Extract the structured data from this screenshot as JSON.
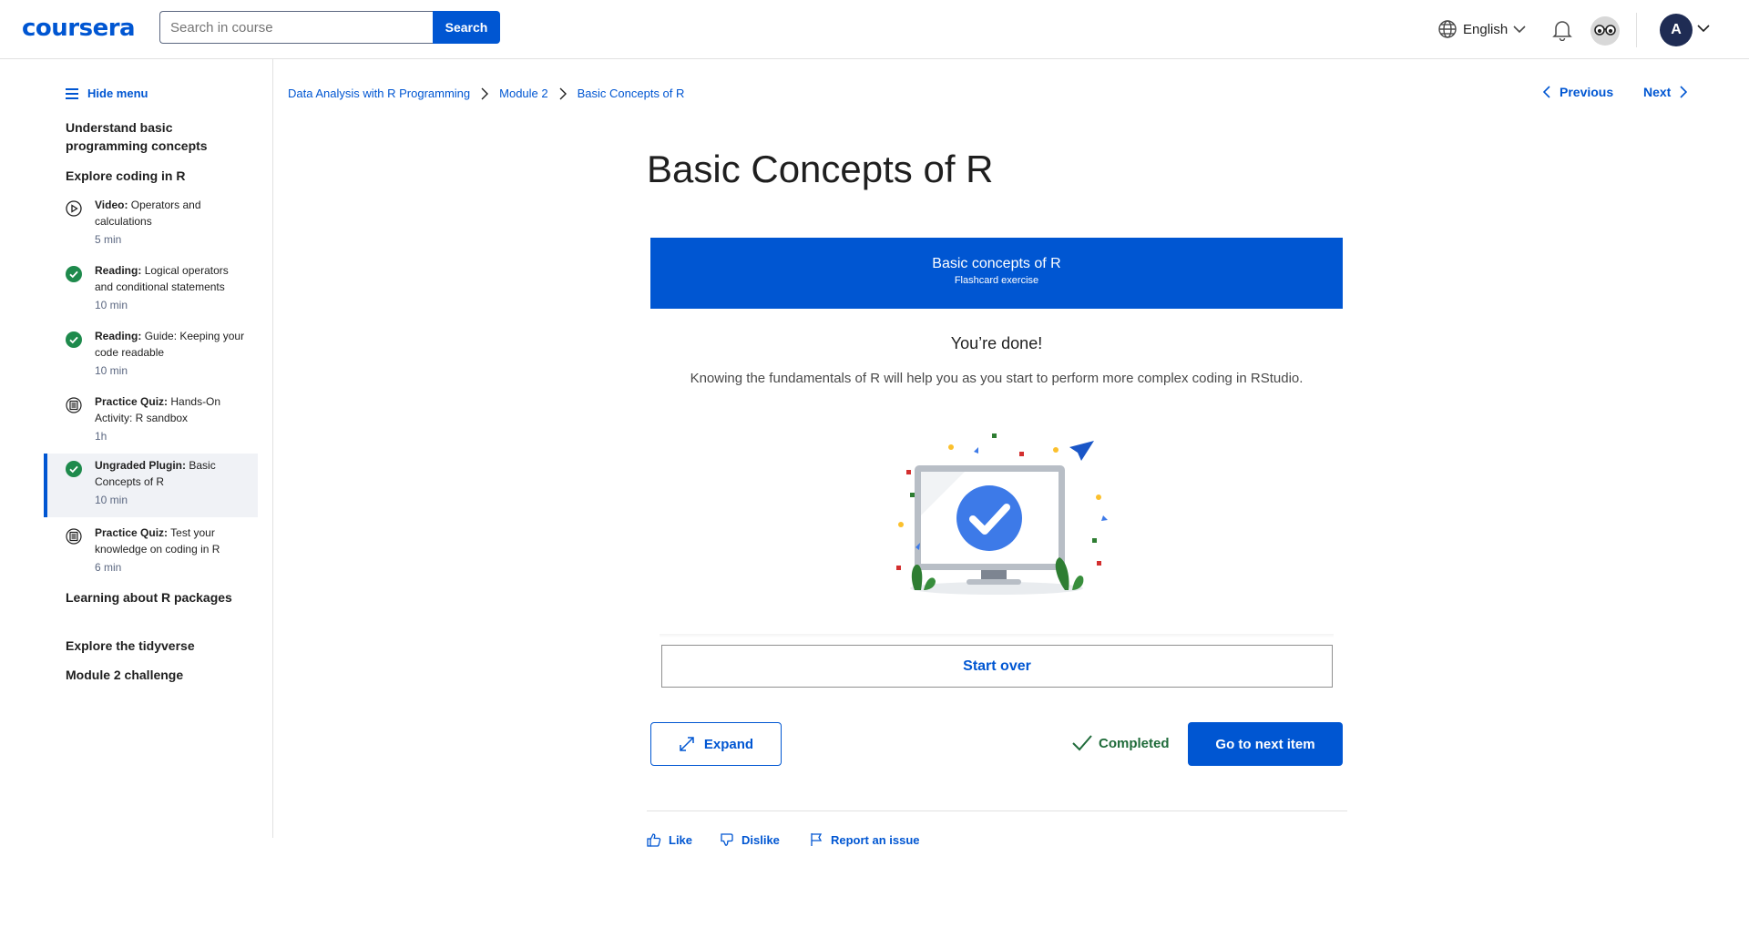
{
  "header": {
    "logo": "coursera",
    "search_placeholder": "Search in course",
    "search_button": "Search",
    "language": "English",
    "avatar_initial": "A"
  },
  "sidebar": {
    "hide_menu": "Hide menu",
    "sections_top": [
      "Understand basic programming concepts",
      "Explore coding in R"
    ],
    "items": [
      {
        "type": "Video:",
        "title": "Operators and calculations",
        "duration": "5 min",
        "icon": "play-circle-icon",
        "status": "not-started"
      },
      {
        "type": "Reading:",
        "title": "Logical operators and conditional statements",
        "duration": "10 min",
        "icon": "check-circle-icon",
        "status": "completed"
      },
      {
        "type": "Reading:",
        "title": "Guide: Keeping your code readable",
        "duration": "10 min",
        "icon": "check-circle-icon",
        "status": "completed"
      },
      {
        "type": "Practice Quiz:",
        "title": "Hands-On Activity: R sandbox",
        "duration": "1h",
        "icon": "quiz-icon",
        "status": "not-started"
      },
      {
        "type": "Ungraded Plugin:",
        "title": "Basic Concepts of R",
        "duration": "10 min",
        "icon": "check-circle-icon",
        "status": "completed"
      },
      {
        "type": "Practice Quiz:",
        "title": "Test your knowledge on coding in R",
        "duration": "6 min",
        "icon": "quiz-icon",
        "status": "not-started"
      }
    ],
    "sections_bottom": [
      "Learning about R packages",
      "Explore the tidyverse",
      "Module 2 challenge"
    ]
  },
  "breadcrumb": [
    "Data Analysis with R Programming",
    "Module 2",
    "Basic Concepts of R"
  ],
  "nav": {
    "previous": "Previous",
    "next": "Next"
  },
  "page_title": "Basic Concepts of R",
  "plugin": {
    "banner_title": "Basic concepts of R",
    "banner_subtitle": "Flashcard exercise",
    "done_title": "You’re done!",
    "done_body": "Knowing the fundamentals of R will help you as you start to perform more complex coding in RStudio.",
    "start_over": "Start over"
  },
  "actions": {
    "expand": "Expand",
    "completed": "Completed",
    "next_item": "Go to next item"
  },
  "feedback": {
    "like": "Like",
    "dislike": "Dislike",
    "report": "Report an issue"
  },
  "colors": {
    "brand": "#0056d2",
    "success": "#1e8a4c",
    "text": "#1f1f1f"
  }
}
